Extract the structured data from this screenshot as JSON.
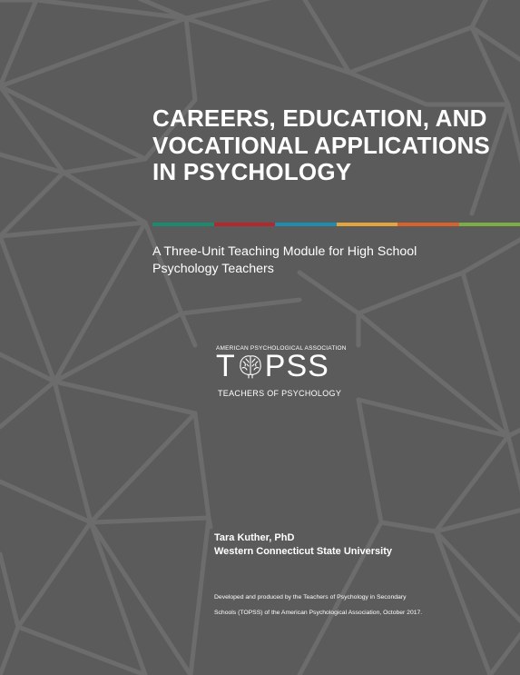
{
  "cover": {
    "title": "CAREERS, EDUCATION, AND VOCATIONAL APPLICATIONS IN PSYCHOLOGY",
    "subtitle": "A Three-Unit Teaching Module for High School Psychology Teachers",
    "accent_colors": [
      "#1b8a6f",
      "#b3282d",
      "#1f8db0",
      "#e6a53a",
      "#d9622b",
      "#7bae43"
    ],
    "background_color": "#5b5b5c",
    "pattern_line_color": "#6c6c6d"
  },
  "logo": {
    "organization": "AMERICAN PSYCHOLOGICAL ASSOCIATION",
    "wordmark_before": "T",
    "wordmark_after": "PSS",
    "brain_icon": "brain-icon",
    "tagline": "TEACHERS OF PSYCHOLOGY"
  },
  "author": {
    "name": "Tara Kuther, PhD",
    "affiliation": "Western Connecticut State University"
  },
  "credit": {
    "line1": "Developed and produced by the Teachers of Psychology in Secondary",
    "line2": "Schools (TOPSS) of the American Psychological Association, October 2017."
  }
}
